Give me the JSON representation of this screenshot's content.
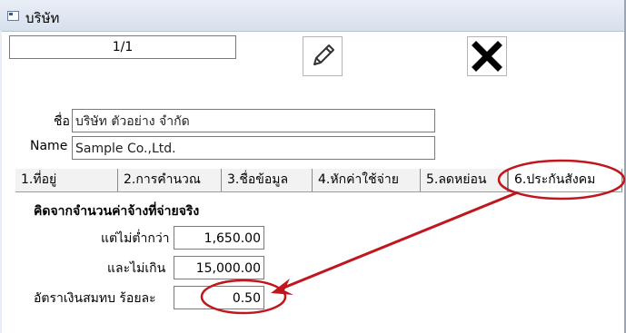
{
  "window": {
    "title": "บริษัท"
  },
  "record": {
    "position": "1/1"
  },
  "toolbar": {
    "edit_icon": "pencil-icon",
    "close_icon": "x-icon"
  },
  "fields": {
    "name_th_label": "ชื่อ",
    "name_th_value": "บริษัท ตัวอย่าง จำกัด",
    "name_en_label": "Name",
    "name_en_value": "Sample Co.,Ltd."
  },
  "tabs": [
    {
      "label": "1.ที่อยู่"
    },
    {
      "label": "2.การคำนวณ"
    },
    {
      "label": "3.ชื่อข้อมูล"
    },
    {
      "label": "4.หักค่าใช้จ่าย"
    },
    {
      "label": "5.ลดหย่อน"
    },
    {
      "label": "6.ประกันสังคม"
    }
  ],
  "social_security": {
    "section_title": "คิดจากจำนวนค่าจ้างที่จ่ายจริง",
    "min_label": "แต่ไม่ต่ำกว่า",
    "min_value": "1,650.00",
    "max_label": "และไม่เกิน",
    "max_value": "15,000.00",
    "rate_label": "อัตราเงินสมทบ ร้อยละ",
    "rate_value": "0.50"
  },
  "annotation_color": "#c0161e"
}
